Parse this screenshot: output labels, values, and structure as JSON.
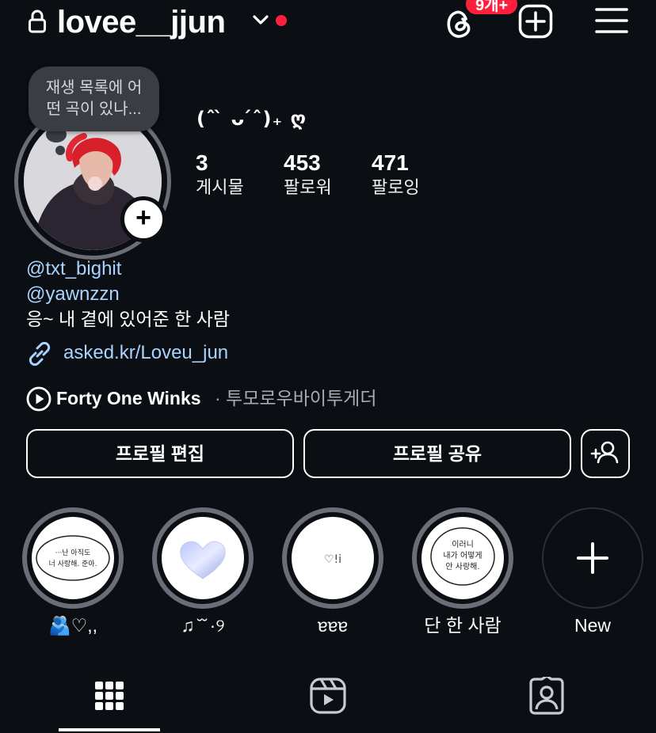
{
  "header": {
    "username": "lovee__jjun",
    "notification_badge": "9개+"
  },
  "note": {
    "text_line1": "재생 목록에 어",
    "text_line2": "떤 곡이 있나..."
  },
  "profile": {
    "display_name": "(ˆ ̀ ᴗ ́ˆ)₊ ღ",
    "stats": [
      {
        "value": "3",
        "label": "게시물"
      },
      {
        "value": "453",
        "label": "팔로워"
      },
      {
        "value": "471",
        "label": "팔로잉"
      }
    ],
    "mentions": [
      "@txt_bighit",
      "@yawnzzn"
    ],
    "bio": "응~ 내 곁에 있어준 한 사람",
    "link": "asked.kr/Loveu_jun",
    "music": {
      "title": "Forty One Winks",
      "artist": "· 투모로우바이투게더"
    }
  },
  "actions": {
    "edit_profile": "프로필 편집",
    "share_profile": "프로필 공유"
  },
  "highlights": [
    {
      "label": "🫂♡,,",
      "cover_text": "···난 아직도\n너 사랑해. 준아."
    },
    {
      "label": "♫ ̆ ̆ ·୨",
      "cover_text": ""
    },
    {
      "label": "ɐɐɐ",
      "cover_text": "♡!i"
    },
    {
      "label": "단 한 사람",
      "cover_text": "이러니\n내가 어떻게\n안 사랑해."
    }
  ],
  "new_highlight_label": "New",
  "colors": {
    "background": "#0b0e13",
    "link_blue": "#a8d4ff",
    "live_red": "#ff1f3d",
    "ring_gray": "#6b6e76"
  }
}
